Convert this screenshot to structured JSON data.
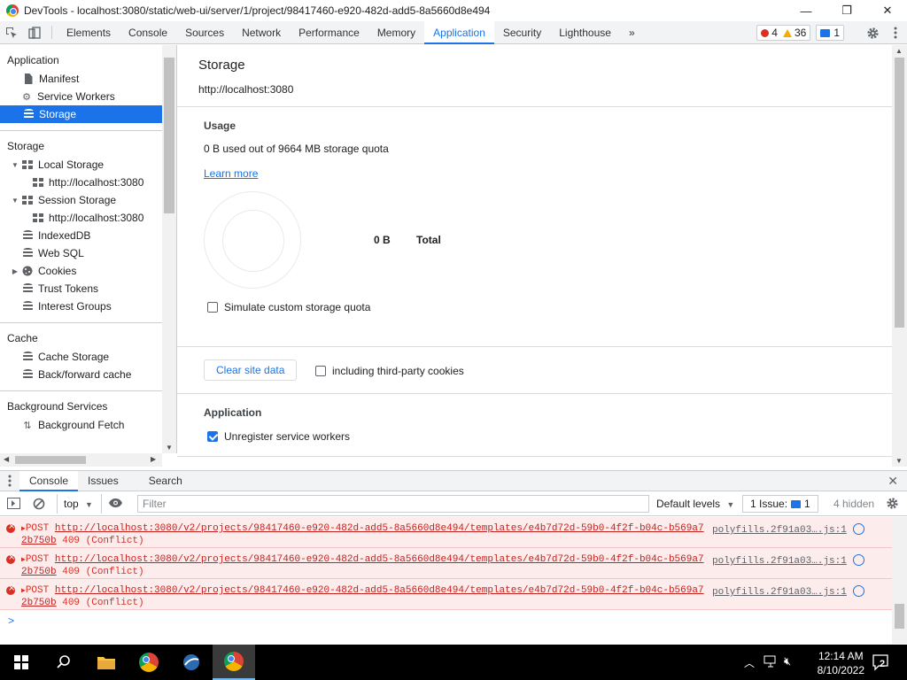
{
  "window": {
    "title": "DevTools - localhost:3080/static/web-ui/server/1/project/98417460-e920-482d-add5-8a5660d8e494",
    "minimize": "—",
    "restore": "❐",
    "close": "✕"
  },
  "toolbar": {
    "tabs": [
      "Elements",
      "Console",
      "Sources",
      "Network",
      "Performance",
      "Memory",
      "Application",
      "Security",
      "Lighthouse"
    ],
    "active_tab": "Application",
    "more": "»",
    "errors": "4",
    "warnings": "36",
    "messages": "1"
  },
  "sidebar": {
    "application_header": "Application",
    "application_items": [
      "Manifest",
      "Service Workers",
      "Storage"
    ],
    "storage_header": "Storage",
    "local_storage": "Local Storage",
    "local_origin": "http://localhost:3080",
    "session_storage": "Session Storage",
    "session_origin": "http://localhost:3080",
    "storage_items": [
      "IndexedDB",
      "Web SQL",
      "Cookies",
      "Trust Tokens",
      "Interest Groups"
    ],
    "cache_header": "Cache",
    "cache_items": [
      "Cache Storage",
      "Back/forward cache"
    ],
    "background_header": "Background Services",
    "background_items": [
      "Background Fetch"
    ]
  },
  "main": {
    "title": "Storage",
    "origin": "http://localhost:3080",
    "usage_header": "Usage",
    "usage_text": "0 B used out of 9664 MB storage quota",
    "learn_more": "Learn more",
    "total_value": "0 B",
    "total_label": "Total",
    "simulate_quota": "Simulate custom storage quota",
    "clear_button": "Clear site data",
    "third_party": "including third-party cookies",
    "application_header": "Application",
    "unregister": "Unregister service workers"
  },
  "drawer": {
    "tabs": [
      "Console",
      "Issues",
      "Search"
    ],
    "context": "top",
    "filter_placeholder": "Filter",
    "levels": "Default levels",
    "issues": "1 Issue:",
    "issues_count": "1",
    "hidden": "4 hidden"
  },
  "console": {
    "messages": [
      {
        "method": "POST",
        "url1": "http://localhost:3080/v2/projects/98417460-e920-482d-add5-8a5660d8e494/templates/e4b7d72d-59b0-4f2f-b04c-b569a7",
        "url2": "2b750b",
        "status": "409 (Conflict)",
        "source": "polyfills.2f91a03….js:1"
      },
      {
        "method": "POST",
        "url1": "http://localhost:3080/v2/projects/98417460-e920-482d-add5-8a5660d8e494/templates/e4b7d72d-59b0-4f2f-b04c-b569a7",
        "url2": "2b750b",
        "status": "409 (Conflict)",
        "source": "polyfills.2f91a03….js:1"
      },
      {
        "method": "POST",
        "url1": "http://localhost:3080/v2/projects/98417460-e920-482d-add5-8a5660d8e494/templates/e4b7d72d-59b0-4f2f-b04c-b569a7",
        "url2": "2b750b",
        "status": "409 (Conflict)",
        "source": "polyfills.2f91a03….js:1"
      }
    ],
    "prompt": ">"
  },
  "taskbar": {
    "time": "12:14 AM",
    "date": "8/10/2022",
    "notifications": "2"
  },
  "colors": {
    "accent": "#1a73e8",
    "error": "#d93025",
    "warning": "#f9ab00"
  }
}
